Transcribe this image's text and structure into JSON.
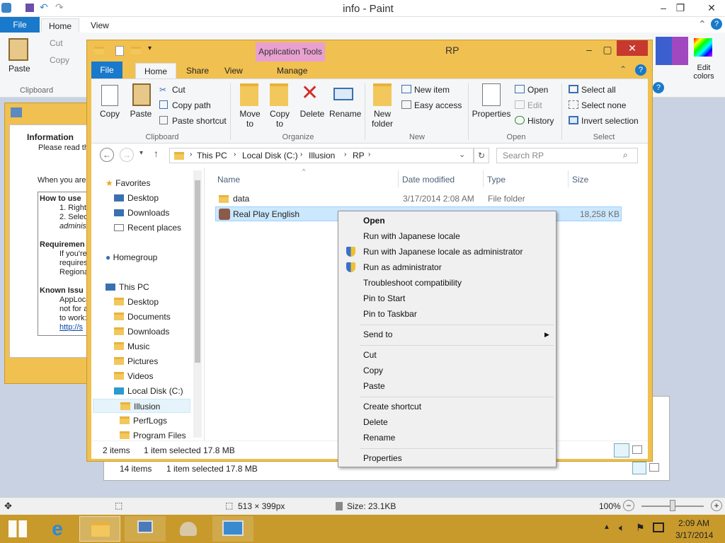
{
  "paint": {
    "title": "info - Paint",
    "tabs": [
      "File",
      "Home",
      "View"
    ],
    "clipboard": {
      "paste": "Paste",
      "cut": "Cut",
      "copy": "Copy",
      "group": "Clipboard"
    },
    "edit_colors": "Edit colors",
    "status": {
      "dimensions": "513 × 399px",
      "size": "Size: 23.1KB",
      "zoom": "100%"
    }
  },
  "dialog": {
    "heading": "Information",
    "subtext": "Please read th",
    "line1": "When you are",
    "how_to_use": "How to use",
    "step1": "1. Right",
    "step2": "2. Selec",
    "step2b": "administ",
    "requirements": "Requiremen",
    "req1": "If you're",
    "req2": "requires",
    "req3": "Regiona",
    "known_issues": "Known Issu",
    "ki1": "AppLoca",
    "ki2": "not for a",
    "ki3": "to work:",
    "ki4": "http://s"
  },
  "explorer_bg": {
    "items": "14 items",
    "selected": "1 item selected  17.8 MB"
  },
  "explorer": {
    "title": "RP",
    "app_tools": "Application Tools",
    "tabs": [
      "File",
      "Home",
      "Share",
      "View",
      "Manage"
    ],
    "ribbon": {
      "copy": "Copy",
      "paste": "Paste",
      "cut": "Cut",
      "copy_path": "Copy path",
      "paste_shortcut": "Paste shortcut",
      "move_to": "Move to",
      "copy_to": "Copy to",
      "delete": "Delete",
      "rename": "Rename",
      "new_folder": "New folder",
      "new_item": "New item",
      "easy_access": "Easy access",
      "properties": "Properties",
      "open": "Open",
      "edit": "Edit",
      "history": "History",
      "select_all": "Select all",
      "select_none": "Select none",
      "invert_selection": "Invert selection",
      "groups": [
        "Clipboard",
        "Organize",
        "New",
        "Open",
        "Select"
      ]
    },
    "address": {
      "path": [
        "This PC",
        "Local Disk (C:)",
        "Illusion",
        "RP"
      ],
      "search_placeholder": "Search RP"
    },
    "nav": {
      "favorites": "Favorites",
      "fav_items": [
        "Desktop",
        "Downloads",
        "Recent places"
      ],
      "homegroup": "Homegroup",
      "this_pc": "This PC",
      "pc_items": [
        "Desktop",
        "Documents",
        "Downloads",
        "Music",
        "Pictures",
        "Videos",
        "Local Disk (C:)"
      ],
      "disk_items": [
        "Illusion",
        "PerfLogs",
        "Program Files"
      ]
    },
    "columns": [
      "Name",
      "Date modified",
      "Type",
      "Size"
    ],
    "files": [
      {
        "name": "data",
        "date": "3/17/2014 2:08 AM",
        "type": "File folder",
        "size": ""
      },
      {
        "name": "Real Play English",
        "date": "",
        "type": "",
        "size": "18,258 KB"
      }
    ],
    "status": {
      "items": "2 items",
      "selected": "1 item selected  17.8 MB"
    }
  },
  "context_menu": {
    "items": [
      "Open",
      "Run with Japanese locale",
      "Run with Japanese locale as administrator",
      "Run as administrator",
      "Troubleshoot compatibility",
      "Pin to Start",
      "Pin to Taskbar",
      "Send to",
      "Cut",
      "Copy",
      "Paste",
      "Create shortcut",
      "Delete",
      "Rename",
      "Properties"
    ]
  },
  "taskbar": {
    "time": "2:09 AM",
    "date": "3/17/2014"
  },
  "colors": {
    "accent": "#f0c050",
    "file_tab": "#1979ca",
    "selection": "#cce8ff",
    "taskbar": "#c89a2c"
  }
}
